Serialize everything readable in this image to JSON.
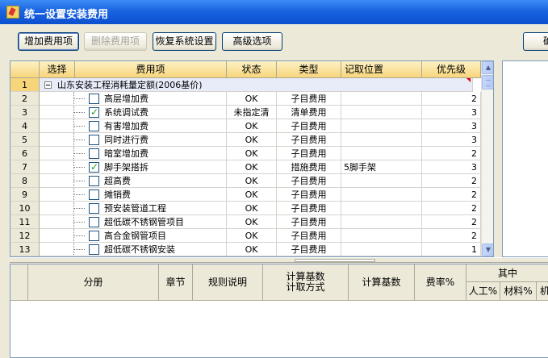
{
  "window": {
    "title": "统一设置安装费用"
  },
  "toolbar": {
    "add_fee": "增加费用项",
    "delete_fee": "删除费用项",
    "restore": "恢复系统设置",
    "advanced": "高级选项",
    "confirm": "确"
  },
  "grid": {
    "headers": {
      "select": "选择",
      "fee_item": "费用项",
      "status": "状态",
      "type": "类型",
      "record_pos": "记取位置",
      "priority": "优先级"
    },
    "group": {
      "row_no": "1",
      "name": "山东安装工程消耗量定额(2006基价)"
    },
    "rows": [
      {
        "no": "2",
        "checked": false,
        "name": "高层增加费",
        "status": "OK",
        "type": "子目费用",
        "pos": "",
        "priority": "2"
      },
      {
        "no": "3",
        "checked": true,
        "name": "系统调试费",
        "status": "未指定清",
        "type": "清单费用",
        "pos": "",
        "priority": "3"
      },
      {
        "no": "4",
        "checked": false,
        "name": "有害增加费",
        "status": "OK",
        "type": "子目费用",
        "pos": "",
        "priority": "3"
      },
      {
        "no": "5",
        "checked": false,
        "name": "同时进行费",
        "status": "OK",
        "type": "子目费用",
        "pos": "",
        "priority": "3"
      },
      {
        "no": "6",
        "checked": false,
        "name": "暗室增加费",
        "status": "OK",
        "type": "子目费用",
        "pos": "",
        "priority": "2"
      },
      {
        "no": "7",
        "checked": true,
        "name": "脚手架搭拆",
        "status": "OK",
        "type": "措施费用",
        "pos": "5脚手架",
        "priority": "3"
      },
      {
        "no": "8",
        "checked": false,
        "name": "超高费",
        "status": "OK",
        "type": "子目费用",
        "pos": "",
        "priority": "2"
      },
      {
        "no": "9",
        "checked": false,
        "name": "摊销费",
        "status": "OK",
        "type": "子目费用",
        "pos": "",
        "priority": "2"
      },
      {
        "no": "10",
        "checked": false,
        "name": "预安装管道工程",
        "status": "OK",
        "type": "子目费用",
        "pos": "",
        "priority": "2"
      },
      {
        "no": "11",
        "checked": false,
        "name": "超低碳不锈钢管项目",
        "status": "OK",
        "type": "子目费用",
        "pos": "",
        "priority": "2"
      },
      {
        "no": "12",
        "checked": false,
        "name": "高合金钢管项目",
        "status": "OK",
        "type": "子目费用",
        "pos": "",
        "priority": "2"
      },
      {
        "no": "13",
        "checked": false,
        "name": "超低碳不锈钢安装",
        "status": "OK",
        "type": "子目费用",
        "pos": "",
        "priority": "1"
      }
    ]
  },
  "lower": {
    "headers": {
      "volume": "分册",
      "chapter": "章节",
      "rule_desc": "规则说明",
      "calc_base_method_1": "计算基数",
      "calc_base_method_2": "计取方式",
      "calc_base": "计算基数",
      "rate": "费率%",
      "among": "其中",
      "labor": "人工%",
      "material": "材料%",
      "machine": "机"
    }
  },
  "colors": {
    "title_bar": "#1a64e0",
    "header_bg": "#f7d57b",
    "group_row": "#e8ecf8",
    "check": "#21a121"
  }
}
